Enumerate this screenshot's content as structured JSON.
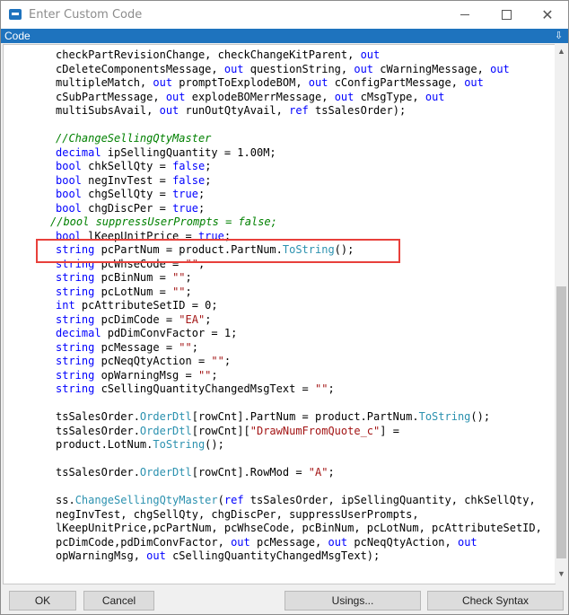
{
  "window": {
    "title": "Enter Custom Code",
    "section_label": "Code",
    "pin_glyph": "⇩",
    "minimize_glyph": "—",
    "maximize_glyph": "☐",
    "close_glyph": "✕",
    "accent_color": "#1e73be"
  },
  "code_lines": [
    [
      [
        "",
        "checkPartRevisionChange, checkChangeKitParent, "
      ],
      [
        "kw",
        "out"
      ]
    ],
    [
      [
        "",
        "cDeleteComponentsMessage, "
      ],
      [
        "kw",
        "out"
      ],
      [
        "",
        " questionString, "
      ],
      [
        "kw",
        "out"
      ],
      [
        "",
        " cWarningMessage, "
      ],
      [
        "kw",
        "out"
      ]
    ],
    [
      [
        "",
        "multipleMatch, "
      ],
      [
        "kw",
        "out"
      ],
      [
        "",
        " promptToExplodeBOM, "
      ],
      [
        "kw",
        "out"
      ],
      [
        "",
        " cConfigPartMessage, "
      ],
      [
        "kw",
        "out"
      ]
    ],
    [
      [
        "",
        "cSubPartMessage, "
      ],
      [
        "kw",
        "out"
      ],
      [
        "",
        " explodeBOMerrMessage, "
      ],
      [
        "kw",
        "out"
      ],
      [
        "",
        " cMsgType, "
      ],
      [
        "kw",
        "out"
      ]
    ],
    [
      [
        "",
        "multiSubsAvail, "
      ],
      [
        "kw",
        "out"
      ],
      [
        "",
        " runOutQtyAvail, "
      ],
      [
        "kw",
        "ref"
      ],
      [
        "",
        " tsSalesOrder);"
      ]
    ],
    [],
    [
      [
        "cmt",
        "//ChangeSellingQtyMaster"
      ]
    ],
    [
      [
        "kw",
        "decimal"
      ],
      [
        "",
        " ipSellingQuantity = 1.00M;"
      ]
    ],
    [
      [
        "kw",
        "bool"
      ],
      [
        "",
        " chkSellQty = "
      ],
      [
        "kw",
        "false"
      ],
      [
        "",
        ";"
      ]
    ],
    [
      [
        "kw",
        "bool"
      ],
      [
        "",
        " negInvTest = "
      ],
      [
        "kw",
        "false"
      ],
      [
        "",
        ";"
      ]
    ],
    [
      [
        "kw",
        "bool"
      ],
      [
        "",
        " chgSellQty = "
      ],
      [
        "kw",
        "true"
      ],
      [
        "",
        ";"
      ]
    ],
    [
      [
        "kw",
        "bool"
      ],
      [
        "",
        " chgDiscPer = "
      ],
      [
        "kw",
        "true"
      ],
      [
        "",
        ";"
      ]
    ],
    [
      [
        "cmt",
        "//bool suppressUserPrompts = false;"
      ]
    ],
    [
      [
        "kw",
        "bool"
      ],
      [
        "",
        " lKeepUnitPrice = "
      ],
      [
        "kw",
        "true"
      ],
      [
        "",
        ";"
      ]
    ],
    [
      [
        "kw",
        "string"
      ],
      [
        "",
        " pcPartNum = product.PartNum."
      ],
      [
        "mth",
        "ToString"
      ],
      [
        "",
        "();"
      ]
    ],
    [
      [
        "kw",
        "string"
      ],
      [
        "",
        " pcWhseCode = "
      ],
      [
        "str",
        "\"\""
      ],
      [
        "",
        ";"
      ]
    ],
    [
      [
        "kw",
        "string"
      ],
      [
        "",
        " pcBinNum = "
      ],
      [
        "str",
        "\"\""
      ],
      [
        "",
        ";"
      ]
    ],
    [
      [
        "kw",
        "string"
      ],
      [
        "",
        " pcLotNum = "
      ],
      [
        "str",
        "\"\""
      ],
      [
        "",
        ";"
      ]
    ],
    [
      [
        "kw",
        "int"
      ],
      [
        "",
        " pcAttributeSetID = 0;"
      ]
    ],
    [
      [
        "kw",
        "string"
      ],
      [
        "",
        " pcDimCode = "
      ],
      [
        "str",
        "\"EA\""
      ],
      [
        "",
        ";"
      ]
    ],
    [
      [
        "kw",
        "decimal"
      ],
      [
        "",
        " pdDimConvFactor = 1;"
      ]
    ],
    [
      [
        "kw",
        "string"
      ],
      [
        "",
        " pcMessage = "
      ],
      [
        "str",
        "\"\""
      ],
      [
        "",
        ";"
      ]
    ],
    [
      [
        "kw",
        "string"
      ],
      [
        "",
        " pcNeqQtyAction = "
      ],
      [
        "str",
        "\"\""
      ],
      [
        "",
        ";"
      ]
    ],
    [
      [
        "kw",
        "string"
      ],
      [
        "",
        " opWarningMsg = "
      ],
      [
        "str",
        "\"\""
      ],
      [
        "",
        ";"
      ]
    ],
    [
      [
        "kw",
        "string"
      ],
      [
        "",
        " cSellingQuantityChangedMsgText = "
      ],
      [
        "str",
        "\"\""
      ],
      [
        "",
        ";"
      ]
    ],
    [],
    [
      [
        "",
        "tsSalesOrder."
      ],
      [
        "mth",
        "OrderDtl"
      ],
      [
        "",
        "[rowCnt].PartNum = product.PartNum."
      ],
      [
        "mth",
        "ToString"
      ],
      [
        "",
        "();"
      ]
    ],
    [
      [
        "",
        "tsSalesOrder."
      ],
      [
        "mth",
        "OrderDtl"
      ],
      [
        "",
        "[rowCnt]["
      ],
      [
        "str",
        "\"DrawNumFromQuote_c\""
      ],
      [
        "",
        "] ="
      ]
    ],
    [
      [
        "",
        "product.LotNum."
      ],
      [
        "mth",
        "ToString"
      ],
      [
        "",
        "();"
      ]
    ],
    [],
    [
      [
        "",
        "tsSalesOrder."
      ],
      [
        "mth",
        "OrderDtl"
      ],
      [
        "",
        "[rowCnt].RowMod = "
      ],
      [
        "str",
        "\"A\""
      ],
      [
        "",
        ";"
      ]
    ],
    [],
    [
      [
        "",
        "ss."
      ],
      [
        "mth",
        "ChangeSellingQtyMaster"
      ],
      [
        "",
        "("
      ],
      [
        "kw",
        "ref"
      ],
      [
        "",
        " tsSalesOrder, ipSellingQuantity, chkSellQty,"
      ]
    ],
    [
      [
        "",
        "negInvTest, chgSellQty, chgDiscPer, suppressUserPrompts,"
      ]
    ],
    [
      [
        "",
        "lKeepUnitPrice,pcPartNum, pcWhseCode, pcBinNum, pcLotNum, pcAttributeSetID,"
      ]
    ],
    [
      [
        "",
        "pcDimCode,pdDimConvFactor, "
      ],
      [
        "kw",
        "out"
      ],
      [
        "",
        " pcMessage, "
      ],
      [
        "kw",
        "out"
      ],
      [
        "",
        " pcNeqQtyAction, "
      ],
      [
        "kw",
        "out"
      ]
    ],
    [
      [
        "",
        "opWarningMsg, "
      ],
      [
        "kw",
        "out"
      ],
      [
        "",
        " cSellingQuantityChangedMsgText);"
      ]
    ]
  ],
  "footer": {
    "ok_label": "OK",
    "cancel_label": "Cancel",
    "usings_label": "Usings...",
    "check_syntax_label": "Check Syntax"
  }
}
